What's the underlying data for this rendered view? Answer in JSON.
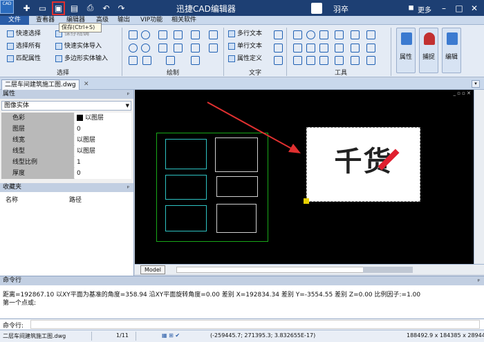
{
  "titlebar": {
    "app_logo": "CAD",
    "title": "迅捷CAD编辑器",
    "user": "羽卒",
    "more": "更多",
    "icons": [
      "new-icon",
      "open-icon",
      "save-icon",
      "save-as-icon",
      "print-icon",
      "undo-icon",
      "redo-icon"
    ]
  },
  "menubar": {
    "items": [
      "文件",
      "查看器",
      "编辑器",
      "高级",
      "输出",
      "VIP功能",
      "相关软件"
    ]
  },
  "tooltip": "保存(Ctrl+S)",
  "ribbon": {
    "select": {
      "title": "选择",
      "items": [
        "快速选择",
        "选择所有",
        "匹配属性"
      ]
    },
    "select2": {
      "items": [
        "保存精确",
        "快速实体导入",
        "多边形实体输入"
      ]
    },
    "draw": {
      "title": "绘制"
    },
    "text": {
      "title": "文字",
      "items": [
        "多行文本",
        "单行文本",
        "属性定义"
      ]
    },
    "tools": {
      "title": "工具"
    },
    "big_buttons": [
      "属性",
      "捕捉",
      "编辑"
    ]
  },
  "document_tab": "二层车间建筑施工图.dwg",
  "properties": {
    "title": "属性",
    "entity_type": "图像实体",
    "rows": [
      {
        "key": "色彩",
        "value": "以图层"
      },
      {
        "key": "图层",
        "value": "0"
      },
      {
        "key": "线宽",
        "value": "以图层"
      },
      {
        "key": "线型",
        "value": "以图层"
      },
      {
        "key": "线型比例",
        "value": "1"
      },
      {
        "key": "厚度",
        "value": "0"
      }
    ]
  },
  "favorites": {
    "title": "收藏夹",
    "col_name": "名称",
    "col_path": "路径"
  },
  "canvas": {
    "model_tab": "Model",
    "preview_text": "千货"
  },
  "command": {
    "title": "命令行",
    "line1": "距离=192867.10  以XY平面为基准的角度=358.94  沿XY平面旋转角度=0.00  差别 X=192834.34  差别 Y=-3554.55  差别 Z=0.00  比例因子:=1.00",
    "line2": "第一个点或:",
    "prompt": "命令行:"
  },
  "status": {
    "file": "二层车间建筑施工图.dwg",
    "page": "1/11",
    "coords": "(-259445.7; 271395.3; 3.832655E-17)",
    "dims": "188492.9 x 184385 x 28944"
  },
  "colors": {
    "titlebar": "#1d3f73",
    "accent": "#2a5da8",
    "highlight": "#e03030",
    "canvas": "#000000"
  }
}
